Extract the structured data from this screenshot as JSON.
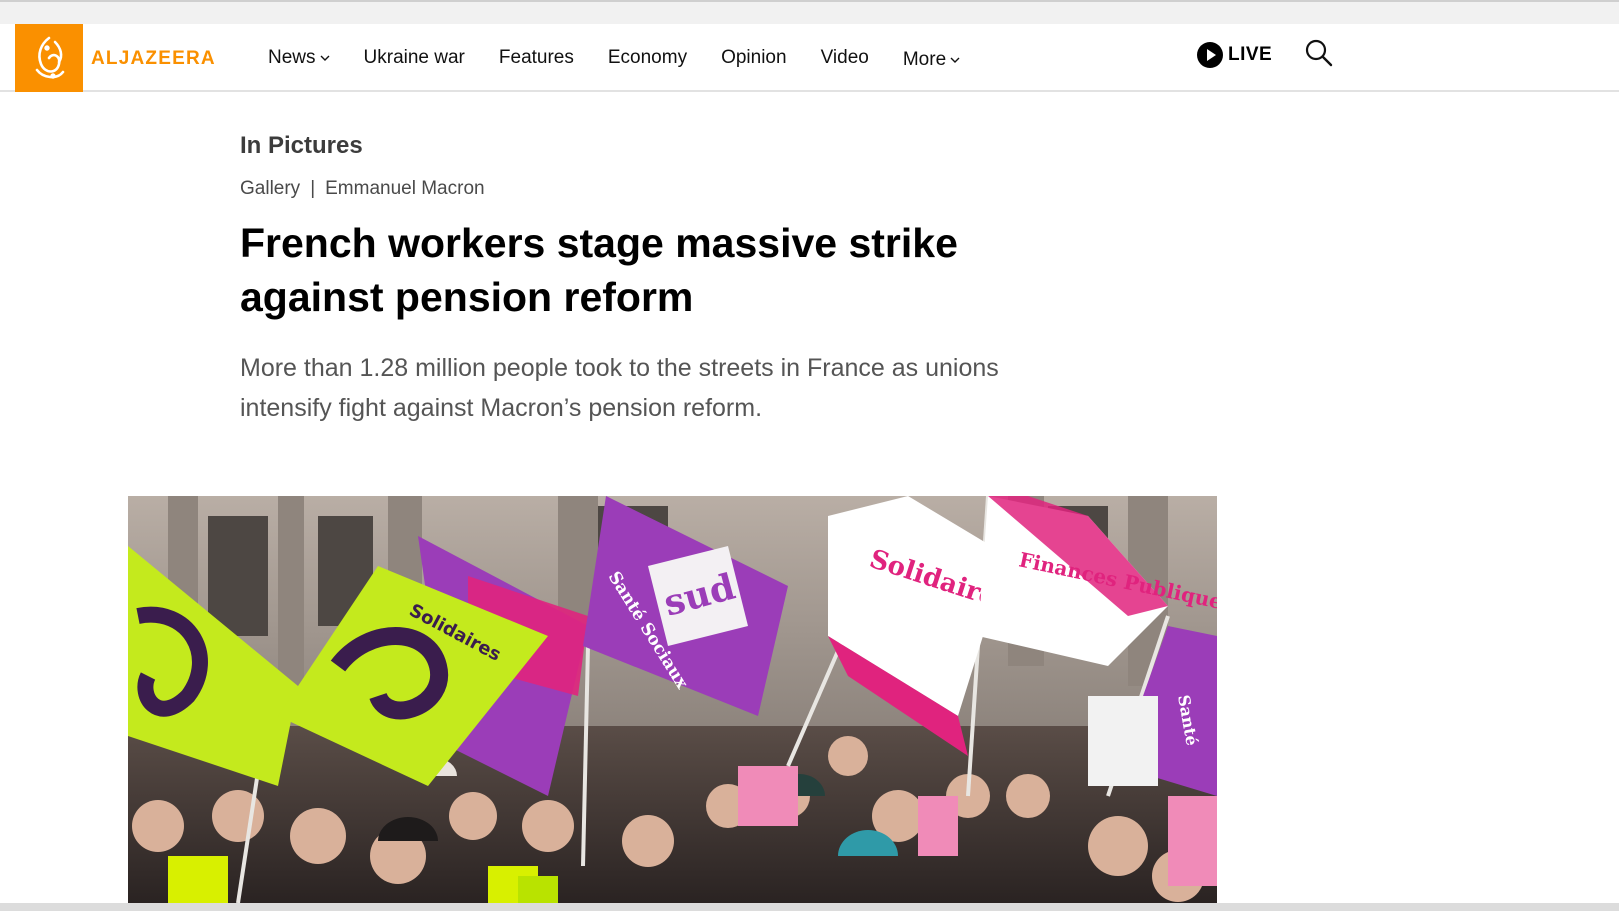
{
  "brand": {
    "name": "ALJAZEERA",
    "color": "#fa9000",
    "logo_icon": "aljazeera-calligraphy-logo"
  },
  "nav": {
    "items": [
      {
        "label": "News",
        "dropdown": true
      },
      {
        "label": "Ukraine war",
        "dropdown": false
      },
      {
        "label": "Features",
        "dropdown": false
      },
      {
        "label": "Economy",
        "dropdown": false
      },
      {
        "label": "Opinion",
        "dropdown": false
      },
      {
        "label": "Video",
        "dropdown": false
      },
      {
        "label": "More",
        "dropdown": true
      }
    ],
    "live_label": "LIVE",
    "live_icon": "play-circle-icon",
    "search_icon": "search-icon"
  },
  "article": {
    "section": "In Pictures",
    "tags": [
      "Gallery",
      "Emmanuel Macron"
    ],
    "tag_separator": "|",
    "headline": "French workers stage massive strike against pension reform",
    "subhead": "More than 1.28 million people took to the streets in France as unions intensify fight against Macron’s pension reform."
  },
  "hero_image": {
    "description_icon": "protest-photo",
    "flag_texts": {
      "sud": "sud",
      "solidaires": "Solidaires",
      "sante_sociaux": "Santé Sociaux",
      "solidaires_finances": "Solidaires",
      "finances_publiques": "Finances Publiques",
      "sante": "Santé"
    }
  },
  "colors": {
    "accent": "#fa9000",
    "flag_green": "#c4ea1d",
    "flag_purple": "#9b3db8",
    "flag_pink": "#e0237e"
  }
}
